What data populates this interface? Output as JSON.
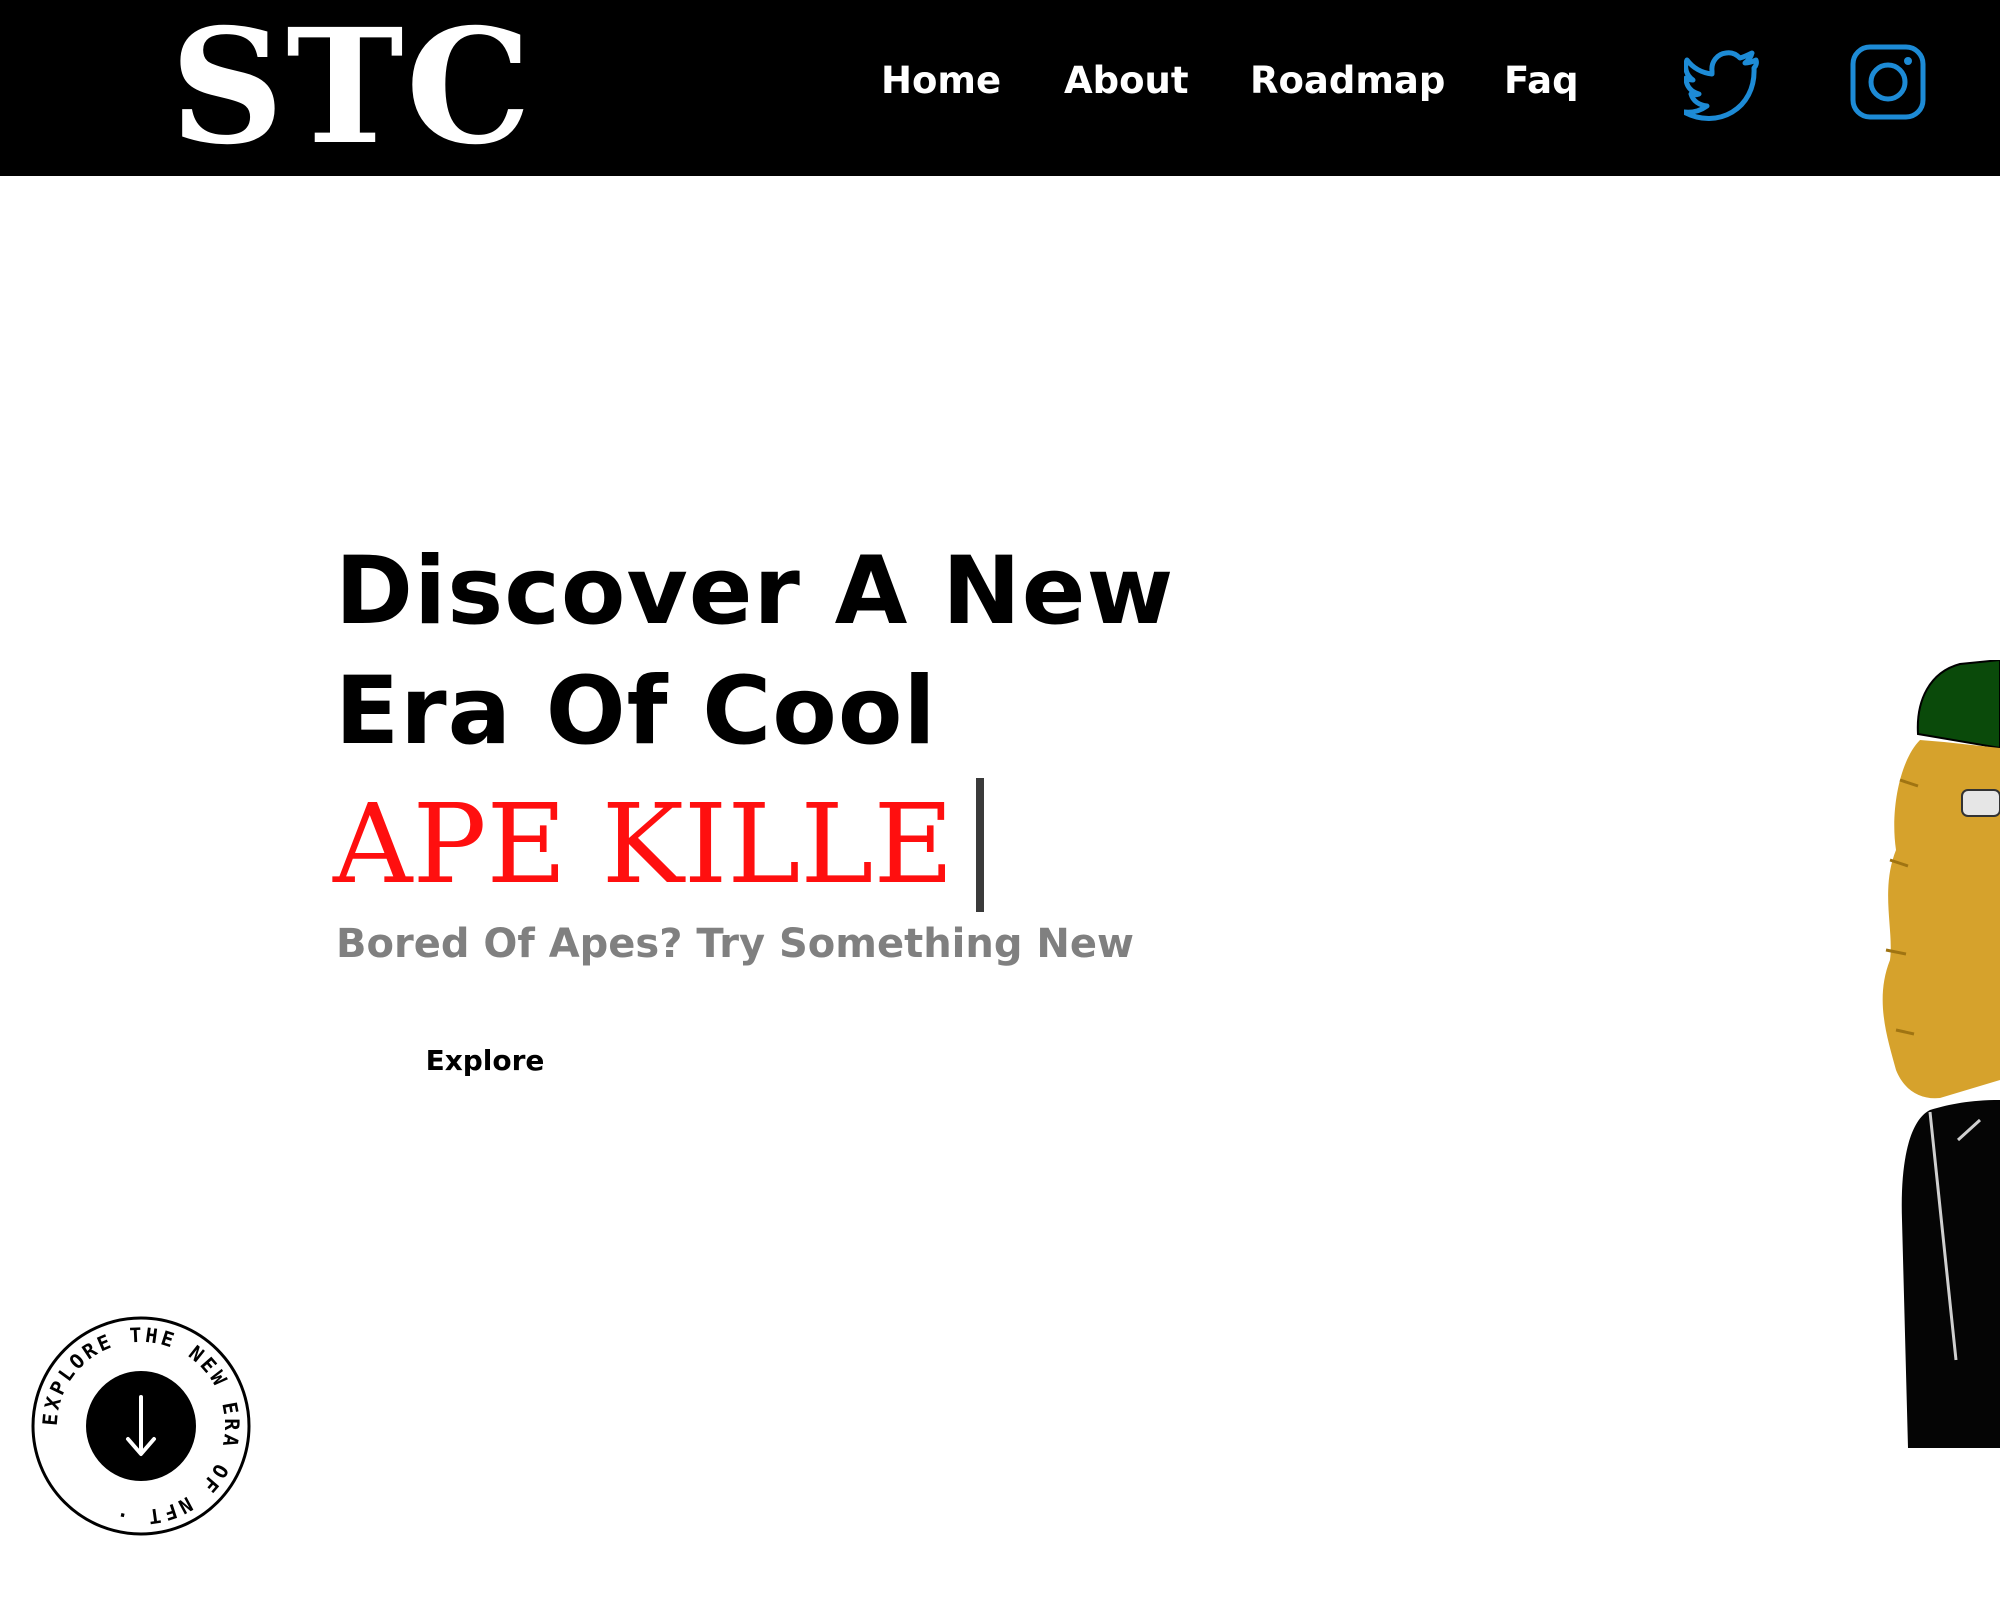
{
  "header": {
    "logo_text": "STC",
    "nav": [
      {
        "label": "Home"
      },
      {
        "label": "About"
      },
      {
        "label": "Roadmap"
      },
      {
        "label": "Faq"
      }
    ],
    "social": [
      {
        "name": "twitter-icon",
        "color": "#1d8bd6"
      },
      {
        "name": "instagram-icon",
        "color": "#1d8bd6"
      }
    ]
  },
  "hero": {
    "headline_line1": "Discover A New",
    "headline_line2": "Era Of Cool",
    "typed_text": "APE KILLE",
    "subtitle": "Bored Of Apes? Try Something New",
    "cta_label": "Explore",
    "badge_text": "EXPLORE THE NEW ERA OF NFT · "
  },
  "colors": {
    "nav_bg": "#000000",
    "nav_text": "#ffffff",
    "accent_red": "#ff0f0f",
    "subtitle_gray": "#808080",
    "social_blue": "#1d8bd6"
  }
}
